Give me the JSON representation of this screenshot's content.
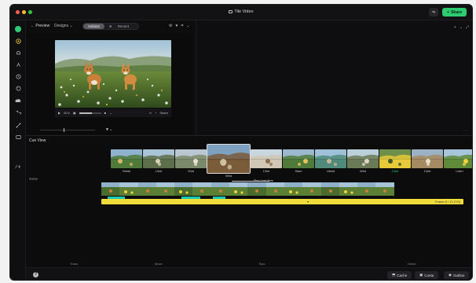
{
  "window": {
    "title": "Tile Video"
  },
  "colors": {
    "accent": "#2ecc71",
    "teal": "#17c8b5",
    "yellow": "#f0dc3a"
  },
  "titlebar": {
    "share_label": "Share",
    "ctrl_icon": "sliders-icon"
  },
  "sidebar": {
    "items": [
      {
        "icon": "brand-icon"
      },
      {
        "icon": "home-icon"
      },
      {
        "icon": "bell-icon"
      },
      {
        "icon": "cut-icon"
      },
      {
        "icon": "clock-icon"
      },
      {
        "icon": "palette-icon"
      },
      {
        "icon": "cloud-icon"
      },
      {
        "icon": "sparkle-icon"
      },
      {
        "icon": "share-icon"
      },
      {
        "icon": "image-icon"
      },
      {
        "icon": "fx-icon"
      }
    ]
  },
  "subtoolbar": {
    "back_label": "Preview",
    "crumb_label": "Designs",
    "tabs": [
      {
        "label": "Actions",
        "active": true
      },
      {
        "label": "Recent",
        "active": false
      }
    ]
  },
  "player": {
    "time_label": "00:0",
    "speed_label": "Share",
    "volume_level": 0.6
  },
  "timeline": {
    "section_label": "Cue View",
    "lane_label": "Gene",
    "thumb_labels": [
      "Retail",
      "13ret",
      "Shtd",
      "Wtrd",
      "13ret",
      "Stare",
      "Ltbeld",
      "Wtrd",
      "13ret",
      "13ret",
      "Lelen"
    ],
    "selected_index": 8,
    "marker_label": "Plan Live View",
    "bar_label": "Frame 6 / 13 (7/2)",
    "ruler": [
      "Trans",
      "Move",
      "Tiulo",
      "Gelse"
    ]
  },
  "bottombar": {
    "help_label": "?",
    "buttons": [
      {
        "label": "Cache"
      },
      {
        "label": "Conta"
      },
      {
        "label": "Outfine"
      }
    ]
  }
}
